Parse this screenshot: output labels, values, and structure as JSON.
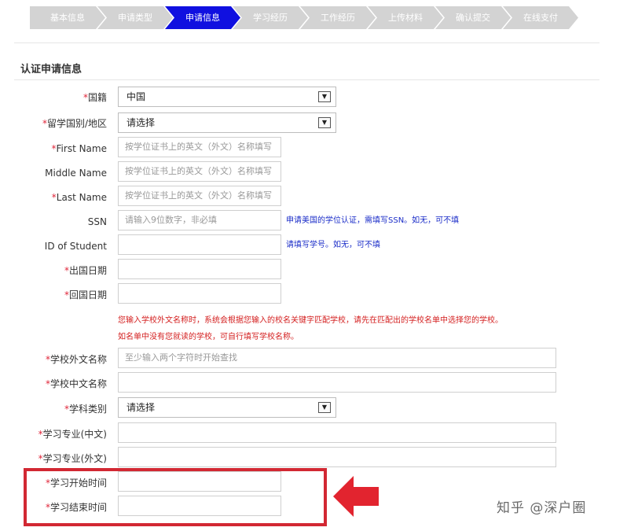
{
  "steps": [
    {
      "label": "基本信息",
      "active": false
    },
    {
      "label": "申请类型",
      "active": false
    },
    {
      "label": "申请信息",
      "active": true
    },
    {
      "label": "学习经历",
      "active": false
    },
    {
      "label": "工作经历",
      "active": false
    },
    {
      "label": "上传材料",
      "active": false
    },
    {
      "label": "确认提交",
      "active": false
    },
    {
      "label": "在线支付",
      "active": false
    }
  ],
  "section_title": "认证申请信息",
  "required_mark": "*",
  "fields": {
    "nationality": {
      "label": "国籍",
      "value": "中国"
    },
    "study_country": {
      "label": "留学国别/地区",
      "value": "请选择"
    },
    "first_name": {
      "label": "First Name",
      "placeholder": "按学位证书上的英文（外文）名称填写"
    },
    "middle_name": {
      "label": "Middle Name",
      "placeholder": "按学位证书上的英文（外文）名称填写"
    },
    "last_name": {
      "label": "Last Name",
      "placeholder": "按学位证书上的英文（外文）名称填写"
    },
    "ssn": {
      "label": "SSN",
      "placeholder": "请输入9位数字，非必填",
      "hint": "申请美国的学位认证，需填写SSN。如无，可不填"
    },
    "student_id": {
      "label": "ID of Student",
      "placeholder": "",
      "hint": "请填写学号。如无，可不填"
    },
    "departure_date": {
      "label": "出国日期",
      "placeholder": ""
    },
    "return_date": {
      "label": "回国日期",
      "placeholder": ""
    },
    "school_notice_line1": "您输入学校外文名称时，系统会根据您输入的校名关键字匹配学校，请先在匹配出的学校名单中选择您的学校。",
    "school_notice_line2": "如名单中没有您就读的学校，可自行填写学校名称。",
    "school_foreign_name": {
      "label": "学校外文名称",
      "placeholder": "至少输入两个字符时开始查找"
    },
    "school_chinese_name": {
      "label": "学校中文名称",
      "placeholder": ""
    },
    "subject_category": {
      "label": "学科类别",
      "value": "请选择"
    },
    "major_chinese": {
      "label": "学习专业(中文)",
      "placeholder": ""
    },
    "major_foreign": {
      "label": "学习专业(外文)",
      "placeholder": ""
    },
    "study_start": {
      "label": "学习开始时间",
      "placeholder": ""
    },
    "study_end": {
      "label": "学习结束时间",
      "placeholder": ""
    }
  },
  "colors": {
    "active_step": "#1010e0",
    "inactive_step": "#d3d3d3",
    "required": "#e0263a",
    "hint": "#1a2cc8",
    "warning": "#d42020",
    "highlight": "#d22833"
  },
  "icons": {
    "select_arrow": "chevron-down-icon",
    "callout": "left-arrow-icon"
  },
  "watermark": "知乎 @深户圈"
}
